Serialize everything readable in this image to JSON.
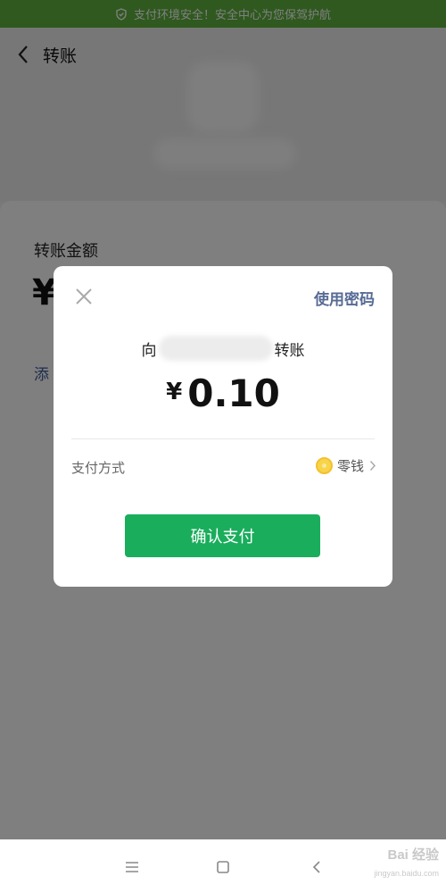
{
  "banner": {
    "text": "支付环境安全！安全中心为您保驾护航",
    "icon": "shield-icon",
    "color": "#5fb33f"
  },
  "header": {
    "title": "转账",
    "back_icon": "chevron-left-icon"
  },
  "transfer": {
    "amount_label": "转账金额",
    "currency": "¥",
    "add_note": "添"
  },
  "dialog": {
    "close_icon": "close-icon",
    "use_password": "使用密码",
    "recipient_prefix": "向",
    "recipient_suffix": "转账",
    "currency": "¥",
    "amount": "0.10",
    "payment_method_label": "支付方式",
    "payment_method_value": "零钱",
    "payment_method_icon": "coin-icon",
    "confirm_label": "确认支付",
    "confirm_color": "#1aad5c"
  },
  "navbar": {
    "menu_icon": "menu-icon",
    "home_icon": "home-icon",
    "back_icon": "back-icon"
  },
  "watermark": {
    "text": "Bai 经验",
    "sub": "jingyan.baidu.com"
  }
}
